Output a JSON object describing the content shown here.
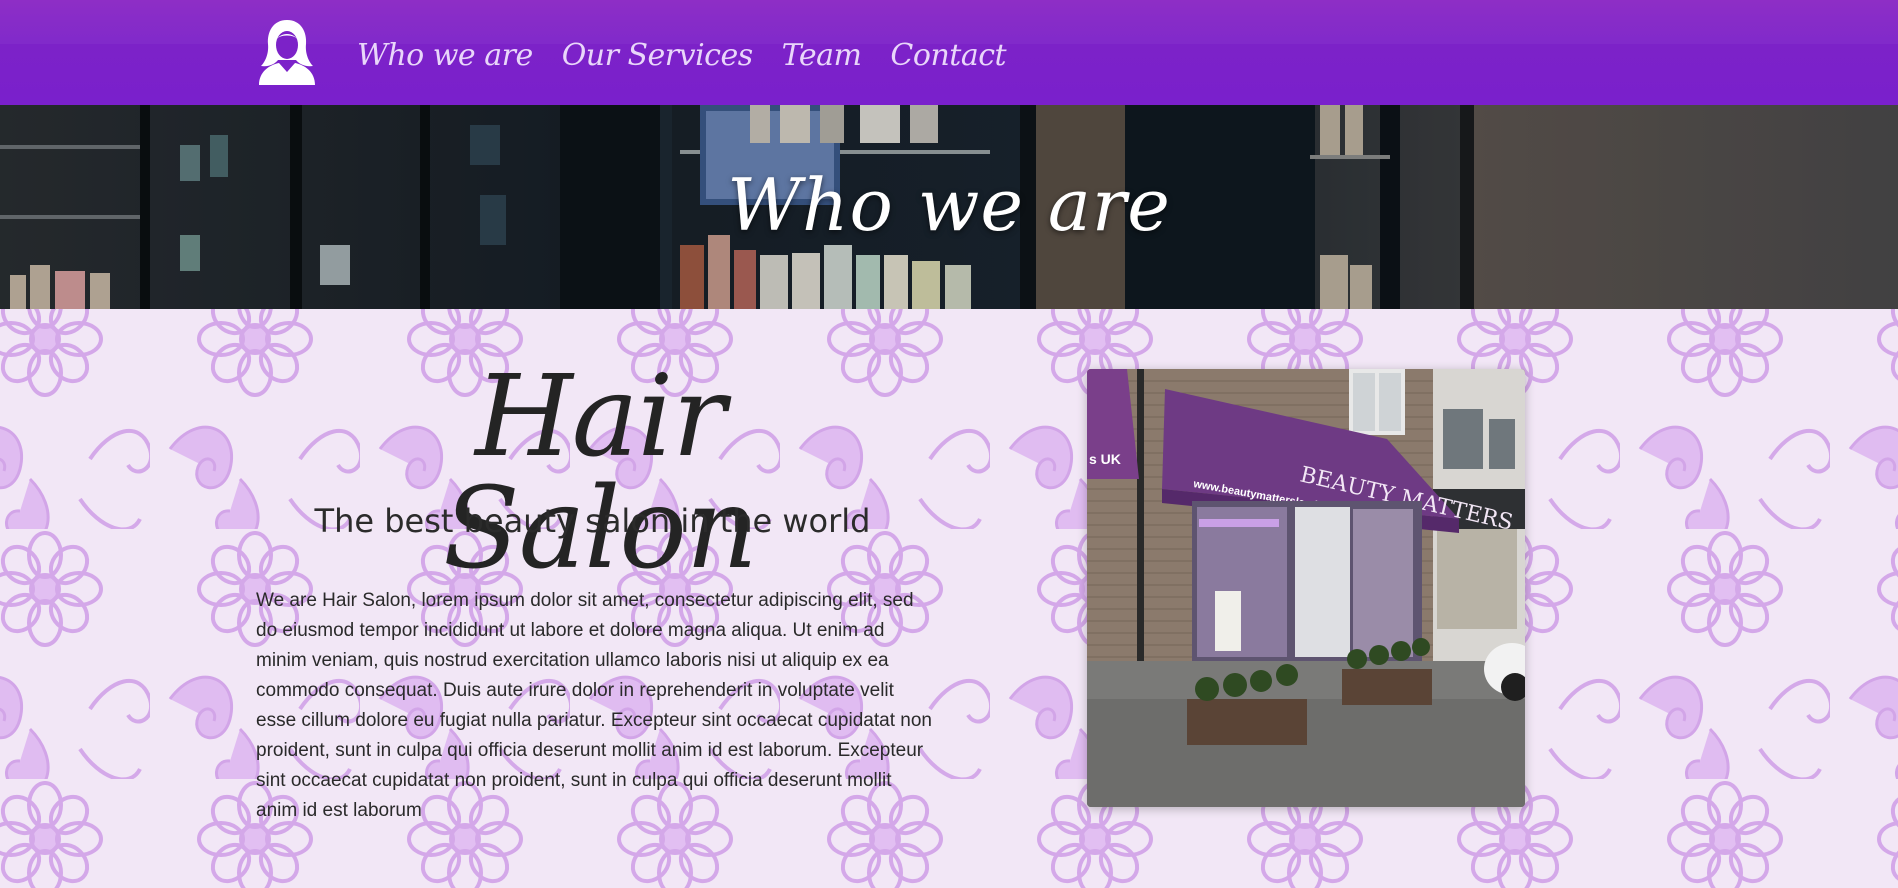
{
  "nav": {
    "logo_icon": "woman-silhouette-icon",
    "links": [
      {
        "label": "Who we are"
      },
      {
        "label": "Our Services"
      },
      {
        "label": "Team"
      },
      {
        "label": "Contact"
      }
    ]
  },
  "hero": {
    "title": "Who we are"
  },
  "about": {
    "brand": "Hair Salon",
    "tagline": "The best beauty salon in the world",
    "description": "We are Hair Salon, lorem ipsum dolor sit amet, consectetur adipiscing elit, sed do eiusmod tempor incididunt ut labore et dolore magna aliqua. Ut enim ad minim veniam, quis nostrud exercitation ullamco laboris nisi ut aliquip ex ea commodo consequat. Duis aute irure dolor in reprehenderit in voluptate velit esse cillum dolore eu fugiat nulla pariatur. Excepteur sint occaecat cupidatat non proident, sunt in culpa qui officia deserunt mollit anim id est laborum. Excepteur sint occaecat cupidatat non proident, sunt in culpa qui officia deserunt mollit anim id est laborum"
  },
  "photo": {
    "awning_text": "BEAUTY MATTERS",
    "awning_url": "www.beautymattersleeds.co.uk",
    "left_sign": "s UK"
  },
  "colors": {
    "nav_bg": "#7b21c9",
    "pattern_bg": "#efe2f5",
    "pattern_motif": "#c98be6",
    "text_dark": "#2a2a2a"
  }
}
